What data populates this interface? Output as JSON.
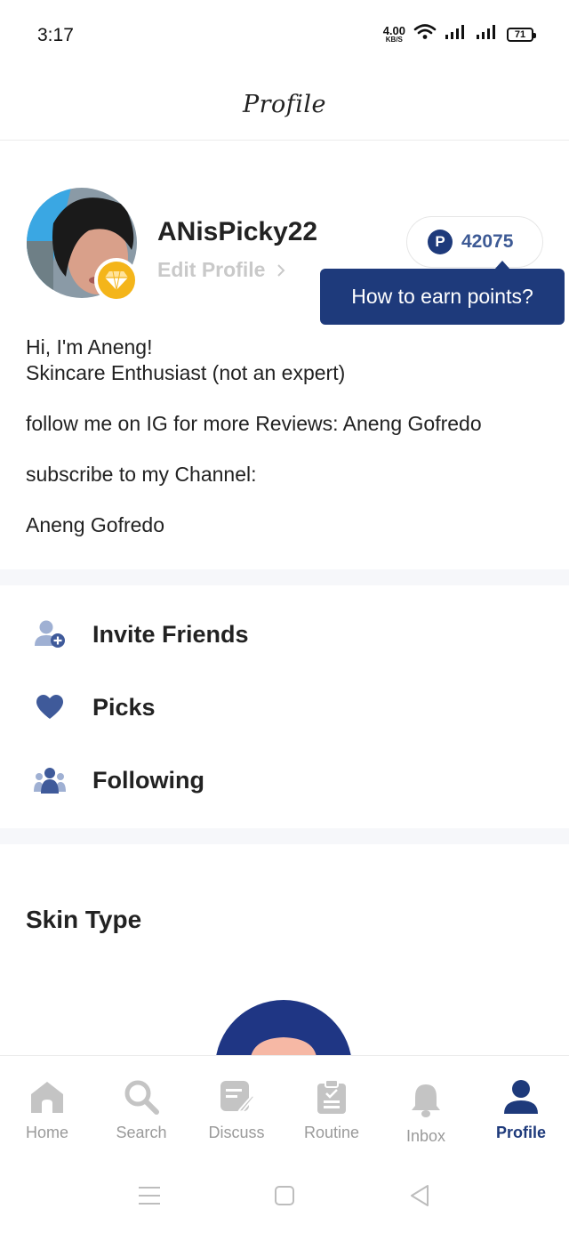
{
  "status_bar": {
    "time": "3:17",
    "net_speed_value": "4.00",
    "net_speed_unit": "KB/S",
    "battery": "71"
  },
  "header": {
    "title": "Profile"
  },
  "profile": {
    "username": "ANisPicky22",
    "edit_label": "Edit Profile",
    "points": "42075",
    "points_badge": "P",
    "tooltip": "How to earn points?",
    "bio": [
      "Hi, I'm Aneng!",
      "Skincare Enthusiast (not an expert)",
      "follow me on IG for more Reviews: Aneng Gofredo",
      "subscribe to my Channel:",
      "Aneng Gofredo"
    ]
  },
  "menu": {
    "items": [
      {
        "label": "Invite Friends",
        "icon": "add-user-icon"
      },
      {
        "label": "Picks",
        "icon": "heart-icon"
      },
      {
        "label": "Following",
        "icon": "group-icon"
      }
    ]
  },
  "skin_type": {
    "title": "Skin Type"
  },
  "bottom_nav": {
    "items": [
      {
        "label": "Home",
        "icon": "home-icon"
      },
      {
        "label": "Search",
        "icon": "search-icon"
      },
      {
        "label": "Discuss",
        "icon": "discuss-icon"
      },
      {
        "label": "Routine",
        "icon": "clipboard-icon"
      },
      {
        "label": "Inbox",
        "icon": "bell-icon"
      },
      {
        "label": "Profile",
        "icon": "person-icon"
      }
    ],
    "active": "Profile"
  },
  "colors": {
    "accent": "#1e3a7b",
    "points_text": "#3d5a95",
    "gem_badge": "#f4b51a",
    "nav_inactive": "#9a9a9a",
    "icon_blue": "#3f5a9a"
  }
}
